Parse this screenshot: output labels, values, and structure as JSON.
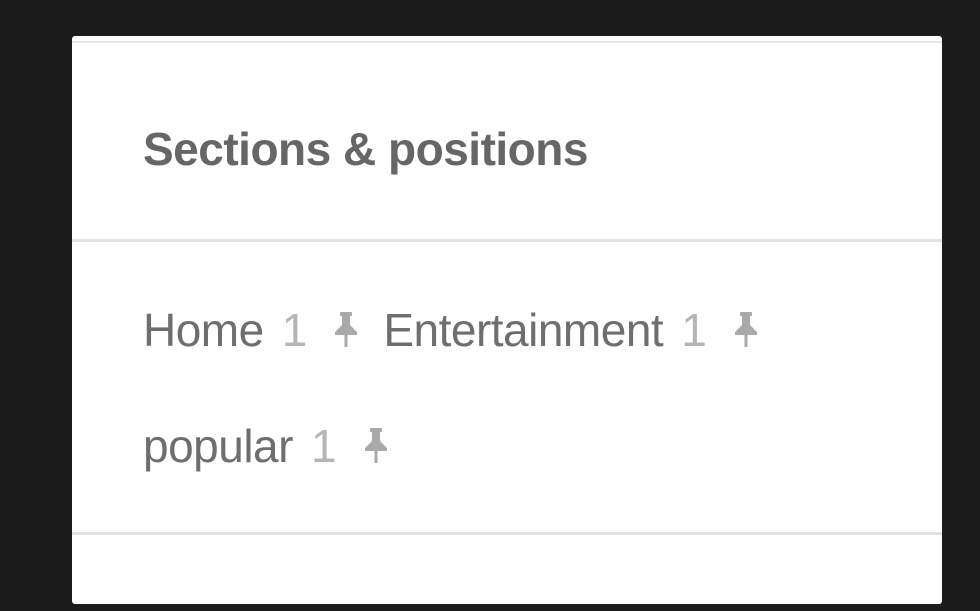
{
  "panel": {
    "title": "Sections & positions",
    "sections": [
      {
        "name": "Home",
        "position": "1",
        "icon": "pin-icon"
      },
      {
        "name": "Entertainment",
        "position": "1",
        "icon": "pin-icon"
      },
      {
        "name": "popular",
        "position": "1",
        "icon": "pin-icon"
      }
    ]
  }
}
